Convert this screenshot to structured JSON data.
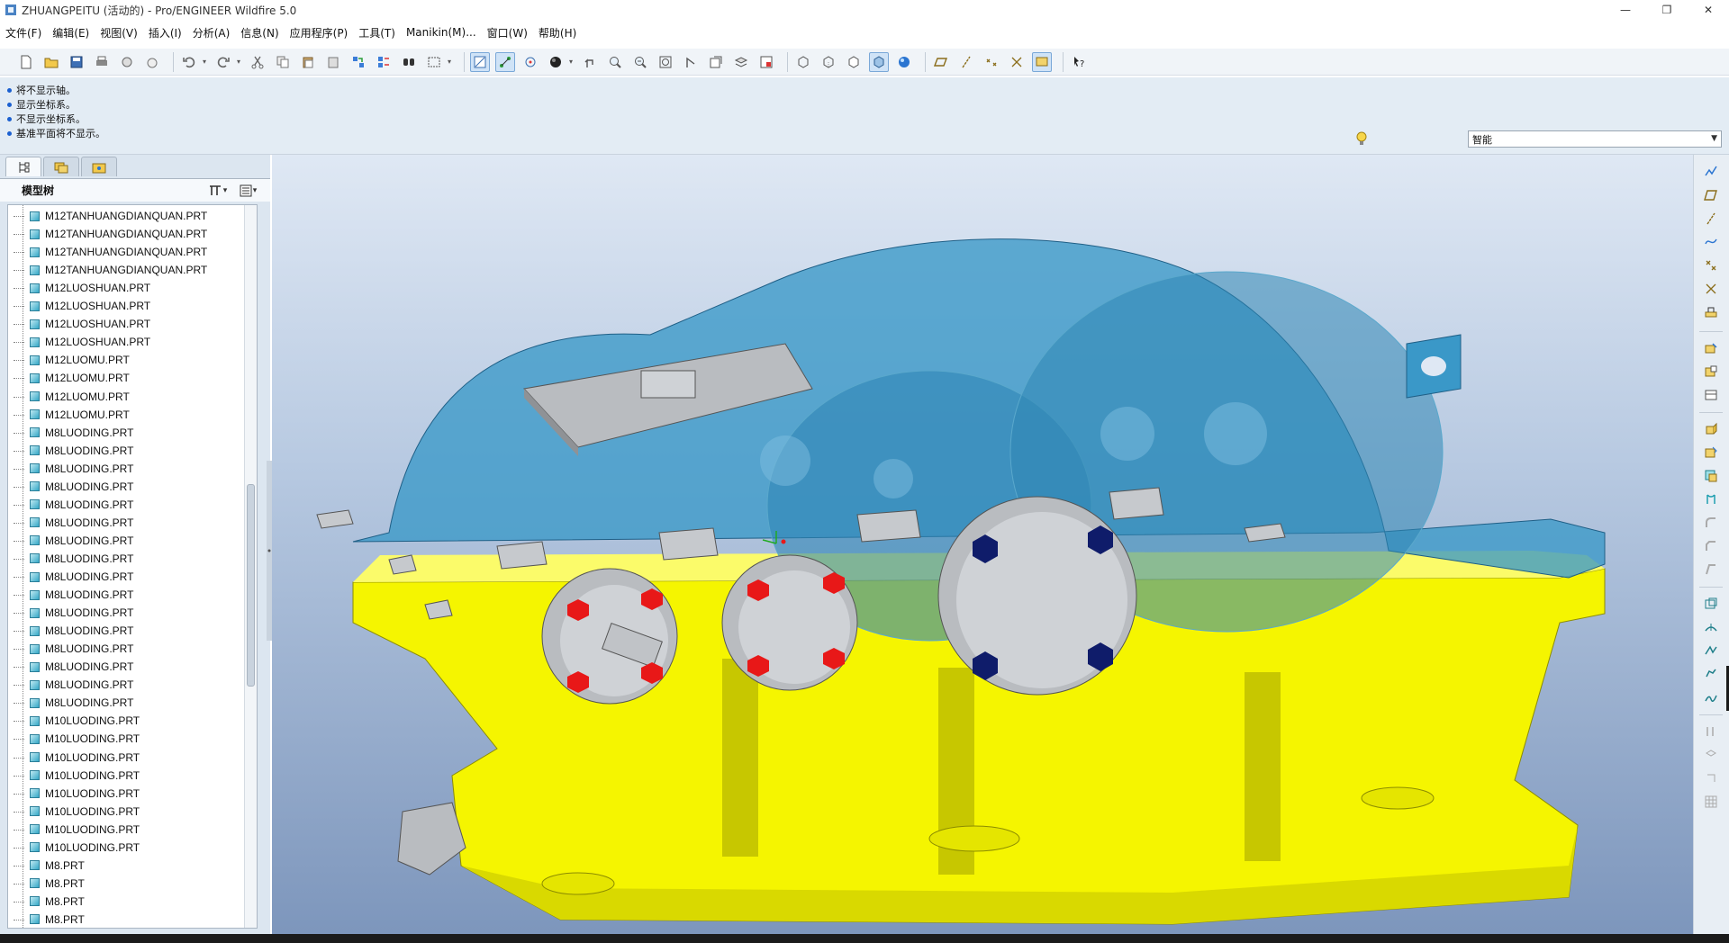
{
  "window": {
    "title": "ZHUANGPEITU (活动的) - Pro/ENGINEER Wildfire 5.0",
    "controls": {
      "minimize": "—",
      "restore": "❐",
      "close": "✕"
    }
  },
  "menu": [
    "文件(F)",
    "编辑(E)",
    "视图(V)",
    "插入(I)",
    "分析(A)",
    "信息(N)",
    "应用程序(P)",
    "工具(T)",
    "Manikin(M)...",
    "窗口(W)",
    "帮助(H)"
  ],
  "toolbar": {
    "icons": [
      "new-icon",
      "open-icon",
      "save-icon",
      "print-icon",
      "send-icon",
      "erase-icon",
      "undo-icon",
      "redo-icon",
      "cut-icon",
      "copy-icon",
      "paste-icon",
      "paste-special-icon",
      "regenerate-icon",
      "regen-manager-icon",
      "find-icon",
      "select-box-icon",
      "datum-display-icon",
      "datum-axis-icon",
      "spin-center-icon",
      "appearance-icon",
      "orient-icon",
      "zoom-in-icon",
      "zoom-out-icon",
      "refit-icon",
      "reorient-icon",
      "saved-views-icon",
      "layers-icon",
      "view-manager-icon",
      "wireframe-icon",
      "hidden-line-icon",
      "no-hidden-icon",
      "shading-icon",
      "enhanced-realism-icon",
      "datum-planes-icon",
      "datum-axes-icon",
      "datum-points-icon",
      "csys-icon",
      "annotations-icon",
      "whats-this-icon"
    ]
  },
  "messages": [
    "将不显示轴。",
    "显示坐标系。",
    "不显示坐标系。",
    "基准平面将不显示。"
  ],
  "filter": {
    "value": "智能"
  },
  "model_tree": {
    "title": "模型树",
    "items": [
      "M12TANHUANGDIANQUAN.PRT",
      "M12TANHUANGDIANQUAN.PRT",
      "M12TANHUANGDIANQUAN.PRT",
      "M12TANHUANGDIANQUAN.PRT",
      "M12LUOSHUAN.PRT",
      "M12LUOSHUAN.PRT",
      "M12LUOSHUAN.PRT",
      "M12LUOSHUAN.PRT",
      "M12LUOMU.PRT",
      "M12LUOMU.PRT",
      "M12LUOMU.PRT",
      "M12LUOMU.PRT",
      "M8LUODING.PRT",
      "M8LUODING.PRT",
      "M8LUODING.PRT",
      "M8LUODING.PRT",
      "M8LUODING.PRT",
      "M8LUODING.PRT",
      "M8LUODING.PRT",
      "M8LUODING.PRT",
      "M8LUODING.PRT",
      "M8LUODING.PRT",
      "M8LUODING.PRT",
      "M8LUODING.PRT",
      "M8LUODING.PRT",
      "M8LUODING.PRT",
      "M8LUODING.PRT",
      "M8LUODING.PRT",
      "M10LUODING.PRT",
      "M10LUODING.PRT",
      "M10LUODING.PRT",
      "M10LUODING.PRT",
      "M10LUODING.PRT",
      "M10LUODING.PRT",
      "M10LUODING.PRT",
      "M10LUODING.PRT",
      "M8.PRT",
      "M8.PRT",
      "M8.PRT",
      "M8.PRT"
    ]
  },
  "right_toolbar": {
    "icons": [
      "sketched-curve-icon",
      "datum-plane-icon",
      "datum-axis-icon",
      "datum-curve-icon",
      "datum-point-icon",
      "csys-icon",
      "analysis-icon",
      "assemble-icon",
      "create-component-icon",
      "package-icon",
      "extrude-icon",
      "revolve-icon",
      "sweep-icon",
      "hole-icon",
      "round-icon",
      "chamfer-icon",
      "draft-icon",
      "shell-icon",
      "rib-icon",
      "pattern-icon",
      "mirror-icon",
      "merge-icon",
      "trim-icon",
      "intersect-icon",
      "offset-icon"
    ]
  },
  "colors": {
    "housing_base": "#f5f500",
    "housing_cover": "#3a98c8",
    "caps": "#b9bcc0",
    "bolt_red": "#e81818",
    "bolt_navy": "#0f1c6a",
    "viewport_top": "#dfe8f4",
    "viewport_bottom": "#7d96bc"
  }
}
